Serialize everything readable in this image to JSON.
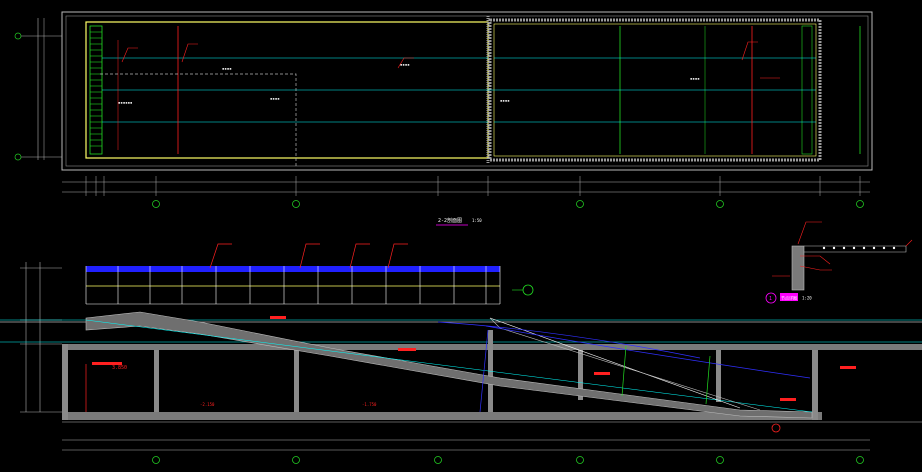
{
  "colors": {
    "background": "#000000",
    "structure": "#b8b8b8",
    "concrete_fill": "#6f6f6f",
    "axis_line": "#00ffff",
    "dimension": "#b0b0b0",
    "wall_yellow": "#ffff66",
    "green": "#22dd22",
    "red": "#ff2020",
    "blue": "#3030ff",
    "white": "#ffffff",
    "magenta": "#ff00ff",
    "grid_bubble": "#22cc22"
  },
  "plan_view": {
    "title": "",
    "section_marker_label": "1"
  },
  "section_view": {
    "title_label": "2-2剖面图",
    "title_scale": "1:50",
    "labels": {
      "elevation_a": "3.850",
      "elevation_b": "-2.150",
      "elevation_c": "-1.750"
    }
  },
  "detail": {
    "bubble": "1",
    "title": "节点详图",
    "scale": "1:20"
  },
  "grid_axes": [
    "1",
    "2",
    "3",
    "4",
    "5"
  ],
  "icons": [
    "section-marker-icon",
    "grid-bubble-icon",
    "detail-bubble-icon",
    "elevation-marker-icon"
  ]
}
